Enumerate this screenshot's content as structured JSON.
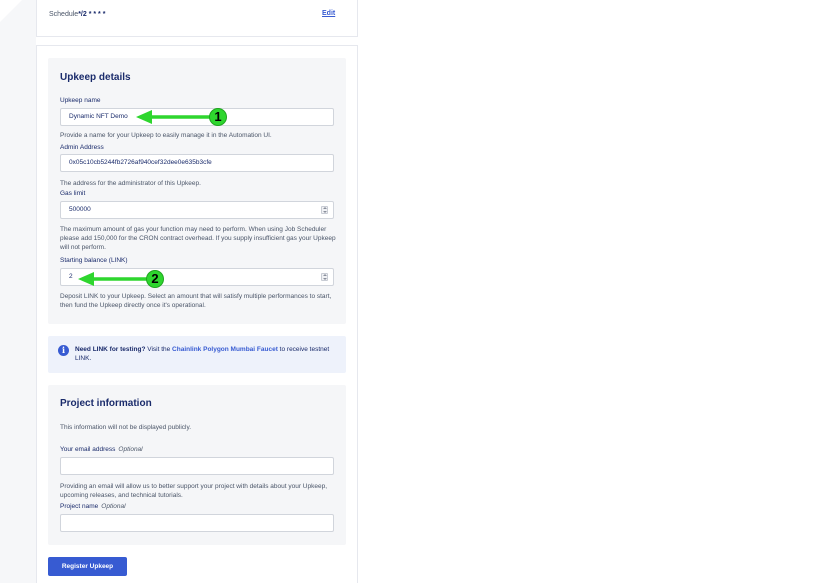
{
  "schedule": {
    "label": "Schedule",
    "value": "*/2 * * * *",
    "edit_label": "Edit"
  },
  "upkeep_details": {
    "title": "Upkeep details",
    "name": {
      "label": "Upkeep name",
      "value": "Dynamic NFT Demo",
      "help": "Provide a name for your Upkeep to easily manage it in the Automation UI."
    },
    "admin": {
      "label": "Admin Address",
      "value": "0x05c10cb5244fb2726af940cef32dee0e635b3cfe",
      "help": "The address for the administrator of this Upkeep."
    },
    "gas": {
      "label": "Gas limit",
      "value": "500000",
      "help": "The maximum amount of gas your function may need to perform. When using Job Scheduler please add 150,000 for the CRON contract overhead. If you supply insufficient gas your Upkeep will not perform."
    },
    "balance": {
      "label": "Starting balance (LINK)",
      "value": "2",
      "help": "Deposit LINK to your Upkeep. Select an amount that will satisfy multiple performances to start, then fund the Upkeep directly once it's operational."
    }
  },
  "info": {
    "bold": "Need LINK for testing?",
    "pre": " Visit the ",
    "link": "Chainlink Polygon Mumbai Faucet",
    "post": " to receive testnet LINK."
  },
  "project": {
    "title": "Project information",
    "note": "This information will not be displayed publicly.",
    "email": {
      "label": "Your email address",
      "optional": "Optional",
      "value": "",
      "help": "Providing an email will allow us to better support your project with details about your Upkeep, upcoming releases, and technical tutorials."
    },
    "project_name": {
      "label": "Project name",
      "optional": "Optional",
      "value": ""
    }
  },
  "register_label": "Register Upkeep",
  "annotations": {
    "badge1": "1",
    "badge2": "2",
    "color": "#2ed62e"
  },
  "colors": {
    "accent": "#375bd2",
    "text": "#1a2b6b",
    "panel": "#f5f6f8",
    "info_bg": "#eef2fb"
  }
}
